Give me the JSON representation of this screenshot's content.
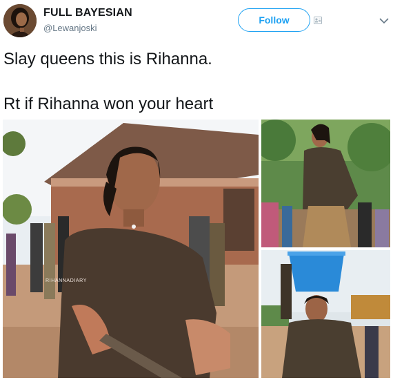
{
  "user": {
    "display_name": "FULL BAYESIAN",
    "handle": "@Lewanjoski"
  },
  "actions": {
    "follow_label": "Follow"
  },
  "icons": {
    "follow": "follow-person-icon",
    "menu": "chevron-down-icon"
  },
  "tweet": {
    "line1": "Slay queens this is Rihanna.",
    "line2": "Rt if Rihanna won your heart"
  },
  "media": {
    "watermark": "RIHANNADIARY",
    "photos": [
      "photo-shoveling",
      "photo-walking",
      "photo-carrying-basin"
    ]
  },
  "colors": {
    "accent": "#1da1f2",
    "text": "#14171a",
    "secondary": "#657786"
  }
}
